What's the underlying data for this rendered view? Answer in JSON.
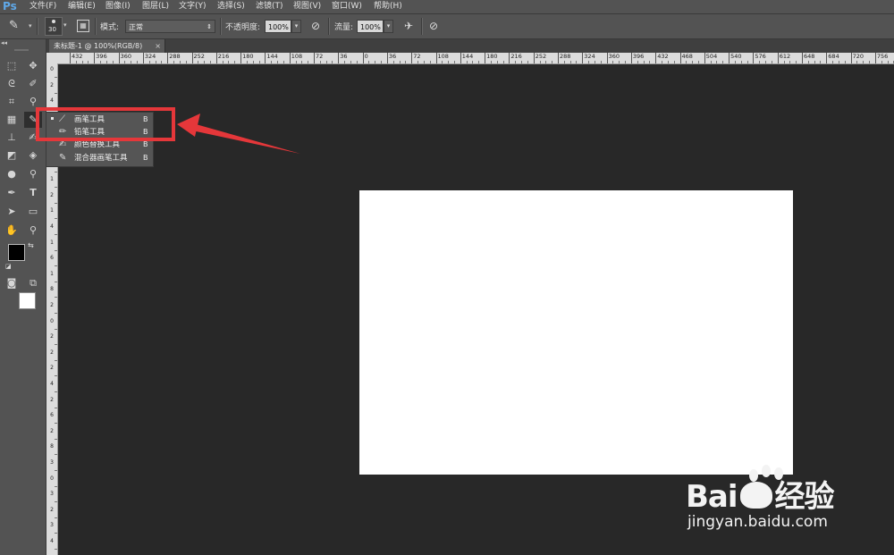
{
  "app": {
    "logo": "Ps"
  },
  "menu": [
    "文件(F)",
    "编辑(E)",
    "图像(I)",
    "图层(L)",
    "文字(Y)",
    "选择(S)",
    "滤镜(T)",
    "视图(V)",
    "窗口(W)",
    "帮助(H)"
  ],
  "options": {
    "brush_size": "30",
    "mode_label": "模式:",
    "mode_value": "正常",
    "opacity_label": "不透明度:",
    "opacity_value": "100%",
    "flow_label": "流量:",
    "flow_value": "100%"
  },
  "document_tab": {
    "title": "未标题-1 @ 100%(RGB/8)",
    "close": "×"
  },
  "ruler_h_labels": [
    "432",
    "396",
    "360",
    "324",
    "288",
    "252",
    "216",
    "180",
    "144",
    "108",
    "72",
    "36",
    "0",
    "36",
    "72",
    "108",
    "144",
    "180",
    "216",
    "252",
    "288",
    "324",
    "360",
    "396",
    "432",
    "468",
    "504",
    "540",
    "576",
    "612",
    "648",
    "684",
    "720",
    "756"
  ],
  "ruler_v_labels": [
    "0",
    "2",
    "4",
    "6",
    "8",
    "1",
    "0",
    "1",
    "2",
    "1",
    "4",
    "1",
    "6",
    "1",
    "8",
    "2",
    "0",
    "2",
    "2",
    "2",
    "4",
    "2",
    "6",
    "2",
    "8",
    "3",
    "0",
    "3",
    "2",
    "3",
    "4"
  ],
  "flyout": {
    "items": [
      {
        "label": "画笔工具",
        "key": "B",
        "icon": "brush-icon",
        "active": true
      },
      {
        "label": "铅笔工具",
        "key": "B",
        "icon": "pencil-icon",
        "active": false
      },
      {
        "label": "颜色替换工具",
        "key": "B",
        "icon": "color-replacement-icon",
        "active": false
      },
      {
        "label": "混合器画笔工具",
        "key": "B",
        "icon": "mixer-brush-icon",
        "active": false
      }
    ]
  },
  "watermark": {
    "brand": "Bai",
    "brand_cn": "经验",
    "url": "jingyan.baidu.com"
  },
  "colors": {
    "annotation_red": "#e5373a",
    "canvas": "#ffffff",
    "workspace": "#282828",
    "panel": "#535353"
  }
}
